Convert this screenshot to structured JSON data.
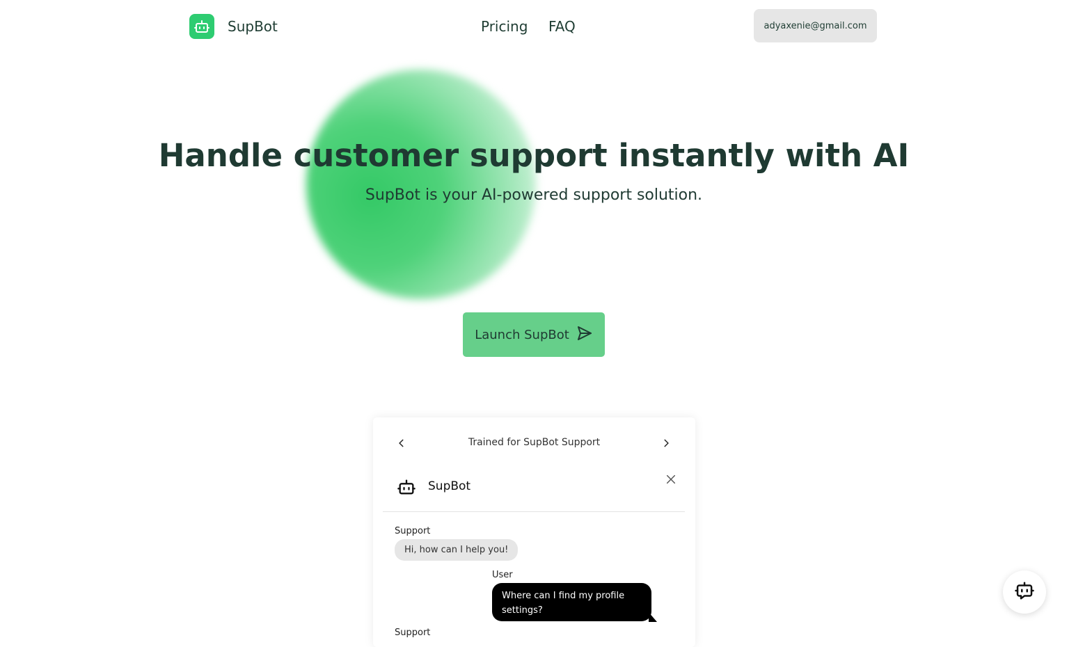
{
  "header": {
    "brand": "SupBot",
    "nav": [
      {
        "label": "Pricing"
      },
      {
        "label": "FAQ"
      }
    ],
    "account_email": "adyaxenie@gmail.com"
  },
  "hero": {
    "title": "Handle customer support instantly with AI",
    "subtitle": "SupBot is your AI-powered support solution.",
    "cta_label": "Launch SupBot"
  },
  "chat_preview": {
    "carousel_title": "Trained for SupBot Support",
    "bot_name": "SupBot",
    "messages": [
      {
        "sender": "Support",
        "text": "Hi, how can I help you!"
      },
      {
        "sender": "User",
        "text": "Where can I find my profile settings?"
      },
      {
        "sender": "Support",
        "text": ""
      }
    ]
  },
  "icons": {
    "logo": "robot-icon",
    "cta": "send-icon",
    "prev": "chevron-left-icon",
    "next": "chevron-right-icon",
    "close": "close-icon",
    "fab": "robot-chat-icon"
  },
  "colors": {
    "brand_green": "#2ecc71",
    "cta_green": "#66cf8a",
    "text_dark": "#1f3a32"
  }
}
